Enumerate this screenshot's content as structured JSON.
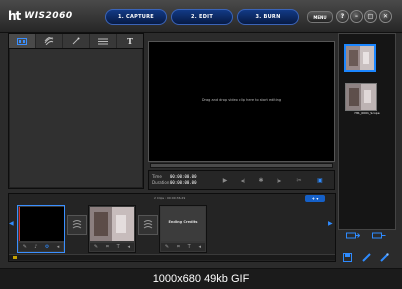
{
  "app": {
    "logo_mark": "ht",
    "logo_name": "WIS2060",
    "steps": [
      {
        "label": "1. CAPTURE",
        "active": false
      },
      {
        "label": "2. EDIT",
        "active": true
      },
      {
        "label": "3. BURN",
        "active": false
      }
    ],
    "menu_label": "MENU",
    "window_buttons": {
      "help": "?",
      "minimize": "–",
      "maximize": "□",
      "close": "✕"
    }
  },
  "library": {
    "tabs": [
      {
        "icon": "video-library-icon",
        "active": true
      },
      {
        "icon": "transition-swirl-icon",
        "active": false
      },
      {
        "icon": "effects-wand-icon",
        "active": false
      },
      {
        "icon": "text-lines-icon",
        "active": false
      },
      {
        "icon": "title-text-icon",
        "glyph": "T",
        "active": false
      }
    ]
  },
  "preview": {
    "message": "Drag and drop video clip here to start editing",
    "time_label": "Time",
    "time_value": "00:00:00.00",
    "duration_label": "Duration",
    "duration_value": "00:00:00.00",
    "controls": [
      {
        "icon": "play-icon",
        "glyph": "▶"
      },
      {
        "icon": "step-back-icon",
        "glyph": "◀|"
      },
      {
        "icon": "settings-icon",
        "glyph": "✱"
      },
      {
        "icon": "step-forward-icon",
        "glyph": "|▶"
      },
      {
        "icon": "cut-icon",
        "glyph": "✂"
      },
      {
        "icon": "snapshot-icon",
        "glyph": "▣"
      }
    ]
  },
  "output": {
    "items": [
      {
        "label": "",
        "selected": true
      },
      {
        "label": "Ht1_0001_Scope",
        "selected": false
      }
    ]
  },
  "storyboard": {
    "info": "2 Clips : 00:00:36.29",
    "add_label": "+ ▾",
    "end_credits_label": "Ending Credits"
  },
  "caption": "1000x680  49kb  GIF",
  "colors": {
    "accent": "#1b86ff",
    "step_bg": "#0b2a66"
  }
}
